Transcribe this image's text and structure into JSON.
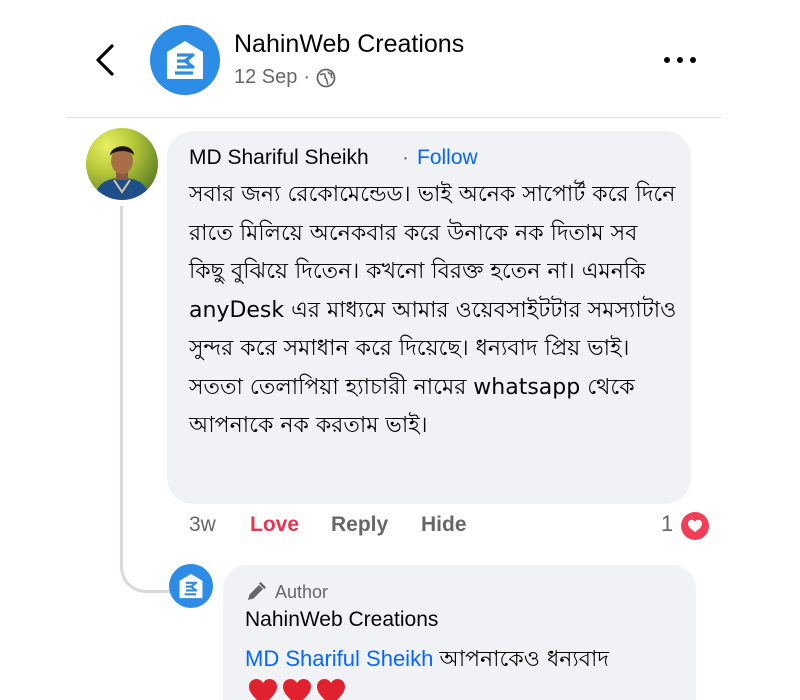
{
  "post": {
    "page_name": "NahinWeb Creations",
    "date": "12 Sep",
    "dot": "·",
    "privacy_icon": "globe-icon"
  },
  "comment": {
    "author": "MD Shariful Sheikh",
    "separator": "·",
    "follow_label": "Follow",
    "text": "সবার জন্য রেকোমেন্ডেড। ভাই অনেক সাপোর্ট করে দিনে রাতে মিলিয়ে অনেকবার করে উনাকে নক দিতাম সব কিছু বুঝিয়ে দিতেন। কখনো বিরক্ত হতেন না। এমনকি anyDesk এর মাধ্যমে আমার ওয়েবসাইটটার সমস্যাটাও সুন্দর করে সমাধান করে দিয়েছে। ধন্যবাদ প্রিয় ভাই। সততা তেলাপিয়া হ্যাচারী নামের whatsapp থেকে আপনাকে নক করতাম ভাই।",
    "time": "3w",
    "love_label": "Love",
    "reply_label": "Reply",
    "hide_label": "Hide",
    "reaction_count": "1",
    "reaction_type": "heart",
    "colors": {
      "love": "#e8344e",
      "link": "#0866ff",
      "muted": "#65676b",
      "bubble": "#f0f2f5"
    }
  },
  "reply": {
    "badge": "Author",
    "author": "NahinWeb Creations",
    "mention": "MD Shariful Sheikh",
    "text": "আপনাকেও ধন্যবাদ",
    "emoji": "❤️❤️❤️"
  },
  "brand_color": "#2d8ce6"
}
